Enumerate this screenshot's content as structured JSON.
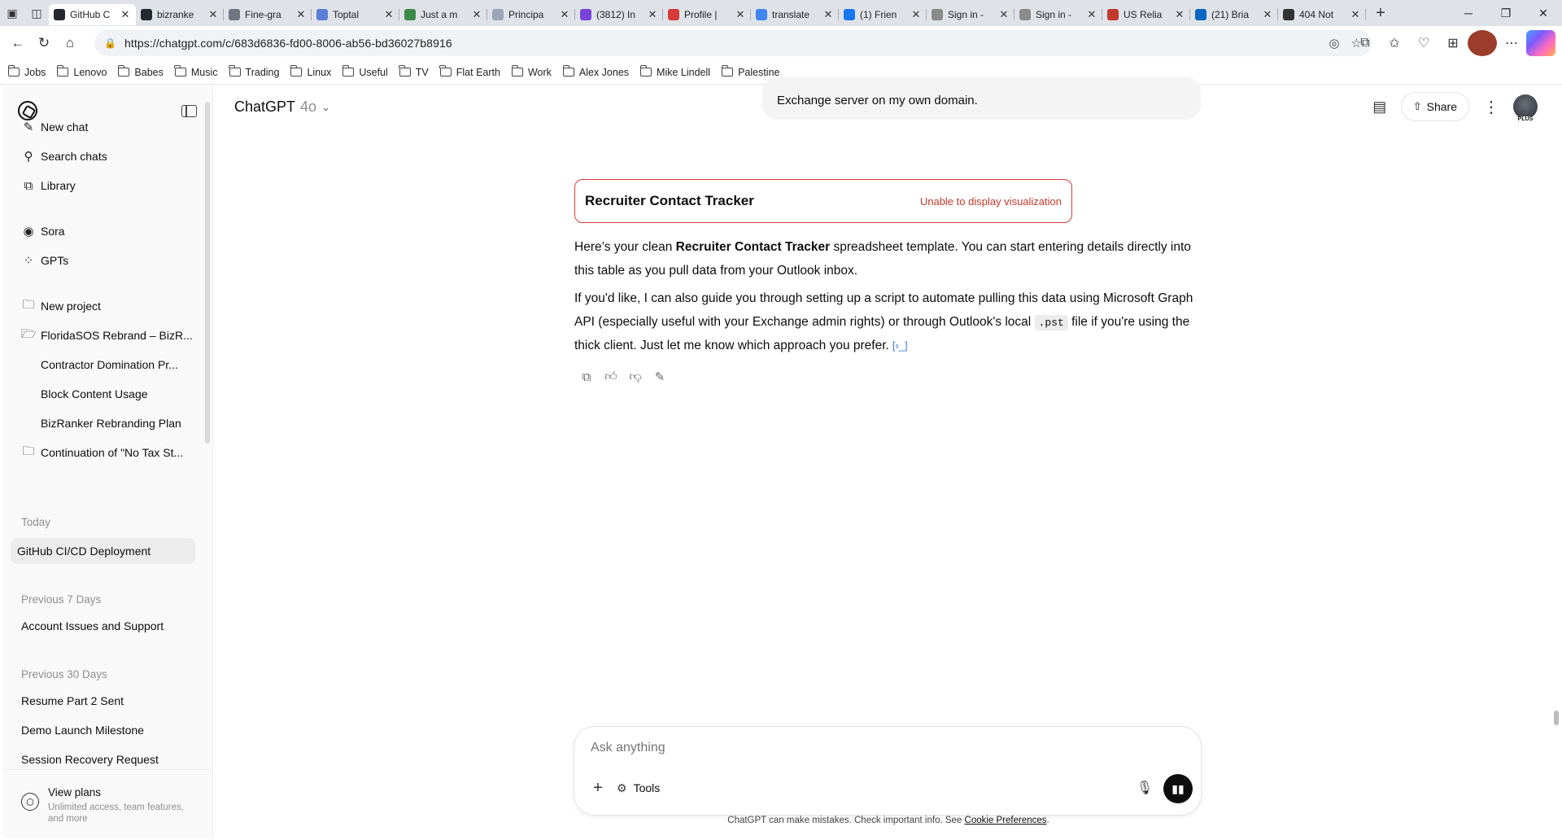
{
  "browser": {
    "tabs": [
      {
        "title": "GitHub C",
        "active": true,
        "color": "#24292f"
      },
      {
        "title": "bizranke",
        "color": "#24292f"
      },
      {
        "title": "Fine-gra",
        "color": "#6e7781"
      },
      {
        "title": "Toptal",
        "color": "#5b7fd6"
      },
      {
        "title": "Just a m",
        "color": "#3c8a4a"
      },
      {
        "title": "Principa",
        "color": "#9aa6b8"
      },
      {
        "title": "(3812) In",
        "color": "#7b44d9"
      },
      {
        "title": "Profile |",
        "color": "#d63a3a"
      },
      {
        "title": "translate",
        "color": "#4285f4"
      },
      {
        "title": "(1) Frien",
        "color": "#1877f2"
      },
      {
        "title": "Sign in -",
        "color": "#8a8a8a"
      },
      {
        "title": "Sign in -",
        "color": "#8a8a8a"
      },
      {
        "title": "US Relia",
        "color": "#c0392b"
      },
      {
        "title": "(21) Bria",
        "color": "#0a66c2"
      },
      {
        "title": "404 Not",
        "color": "#333333"
      }
    ],
    "url": "https://chatgpt.com/c/683d6836-fd00-8006-ab56-bd36027b8916",
    "bookmarks": [
      "Jobs",
      "Lenovo",
      "Babes",
      "Music",
      "Trading",
      "Linux",
      "Useful",
      "TV",
      "Flat Earth",
      "Work",
      "Alex Jones",
      "Mike Lindell",
      "Palestine"
    ]
  },
  "sidebar": {
    "nav": [
      {
        "label": "New chat",
        "icon": "edit-icon"
      },
      {
        "label": "Search chats",
        "icon": "search-icon"
      },
      {
        "label": "Library",
        "icon": "library-icon"
      }
    ],
    "apps": [
      {
        "label": "Sora",
        "icon": "sora-icon"
      },
      {
        "label": "GPTs",
        "icon": "gpts-icon"
      }
    ],
    "projects": [
      {
        "label": "New project"
      },
      {
        "label": "FloridaSOS Rebrand – BizR..."
      },
      {
        "label": "Contractor Domination Pr..."
      },
      {
        "label": "Block Content Usage"
      },
      {
        "label": "BizRanker Rebranding Plan"
      },
      {
        "label": "Continuation of \"No Tax St..."
      }
    ],
    "sections": [
      {
        "heading": "Today",
        "items": [
          "GitHub CI/CD Deployment"
        ]
      },
      {
        "heading": "Previous 7 Days",
        "items": [
          "Account Issues and Support"
        ]
      },
      {
        "heading": "Previous 30 Days",
        "items": [
          "Resume Part 2 Sent",
          "Demo Launch Milestone",
          "Session Recovery Request"
        ]
      }
    ],
    "view_plans": {
      "title": "View plans",
      "subtitle": "Unlimited access, team features, and more"
    }
  },
  "header": {
    "model": "ChatGPT",
    "version": "4o",
    "share": "Share",
    "plan_badge": "PLUS"
  },
  "conversation": {
    "user_message_tail": "Exchange server on my own domain.",
    "viz_card": {
      "title": "Recruiter Contact Tracker",
      "error": "Unable to display visualization"
    },
    "p1_a": "Here’s your clean ",
    "p1_b": "Recruiter Contact Tracker",
    "p1_c": " spreadsheet template. You can start entering details directly into this table as you pull data from your Outlook inbox.",
    "p2_a": "If you'd like, I can also guide you through setting up a script to automate pulling this data using Microsoft Graph API (especially useful with your Exchange admin rights) or through Outlook's local ",
    "p2_code": ".pst",
    "p2_b": " file if you're using the thick client. Just let me know which approach you prefer."
  },
  "composer": {
    "placeholder": "Ask anything",
    "tools": "Tools"
  },
  "footer": {
    "text": "ChatGPT can make mistakes. Check important info. See ",
    "link": "Cookie Preferences",
    "end": "."
  }
}
